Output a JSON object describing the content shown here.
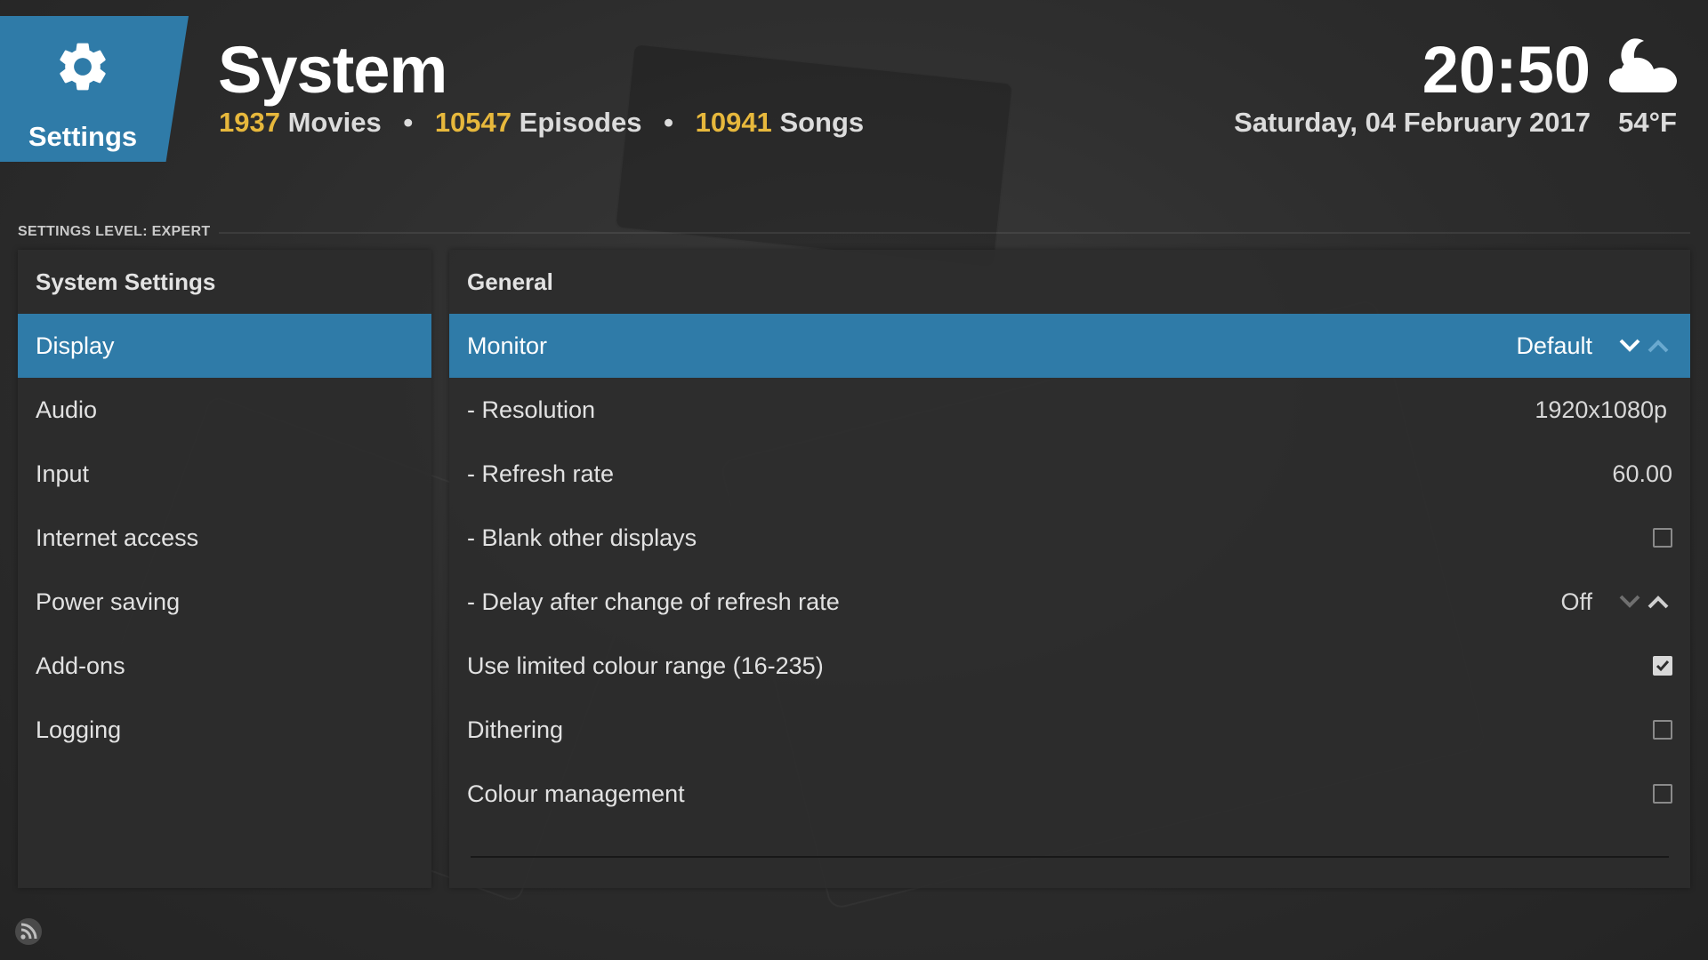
{
  "header": {
    "tile_label": "Settings",
    "title": "System",
    "stats": [
      {
        "count": "1937",
        "label": "Movies"
      },
      {
        "count": "10547",
        "label": "Episodes"
      },
      {
        "count": "10941",
        "label": "Songs"
      }
    ],
    "separator": "•",
    "clock": "20:50",
    "date": "Saturday, 04 February 2017",
    "temperature": "54°F",
    "weather_icon": "partly-cloudy-night-icon"
  },
  "settings_level": "SETTINGS LEVEL: EXPERT",
  "sidebar": {
    "heading": "System Settings",
    "items": [
      {
        "label": "Display",
        "active": true
      },
      {
        "label": "Audio"
      },
      {
        "label": "Input"
      },
      {
        "label": "Internet access"
      },
      {
        "label": "Power saving"
      },
      {
        "label": "Add-ons"
      },
      {
        "label": "Logging"
      }
    ]
  },
  "main": {
    "heading": "General",
    "settings": [
      {
        "label": "Monitor",
        "value": "Default",
        "control": "spinner",
        "active": true
      },
      {
        "label": "- Resolution",
        "value": "1920x1080p",
        "control": "value"
      },
      {
        "label": "- Refresh rate",
        "value": "60.00",
        "control": "value"
      },
      {
        "label": "- Blank other displays",
        "control": "checkbox",
        "checked": false
      },
      {
        "label": "- Delay after change of refresh rate",
        "value": "Off",
        "control": "spinner"
      },
      {
        "label": "Use limited colour range (16-235)",
        "control": "checkbox",
        "checked": true
      },
      {
        "label": "Dithering",
        "control": "checkbox",
        "checked": false
      },
      {
        "label": "Colour management",
        "control": "checkbox",
        "checked": false
      }
    ]
  },
  "colors": {
    "accent": "#2f7ba8",
    "highlight_number": "#e7b83c",
    "panel": "#2c2c2c"
  }
}
